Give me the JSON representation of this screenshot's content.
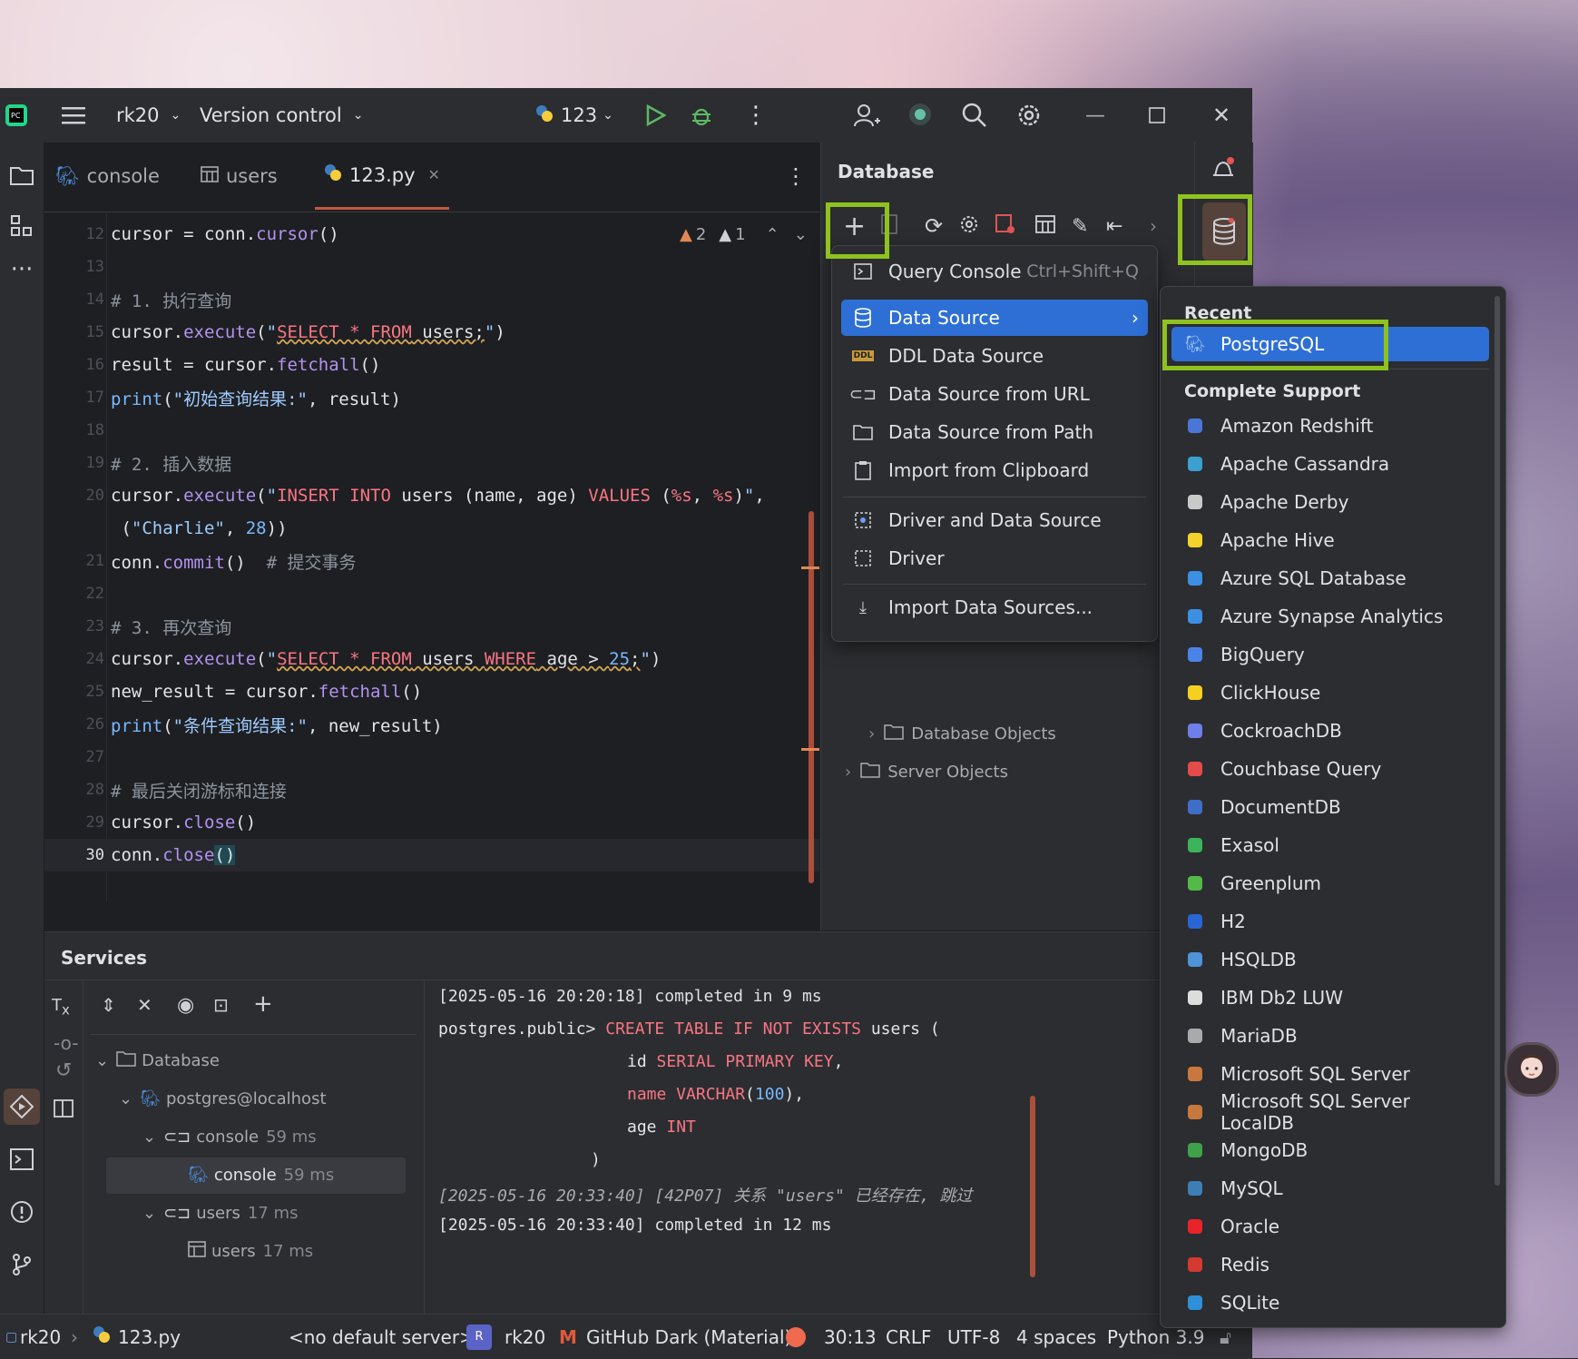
{
  "titlebar": {
    "project": "rk20",
    "vcs": "Version control",
    "run_config": "123"
  },
  "tabs": [
    {
      "label": "console"
    },
    {
      "label": "users"
    },
    {
      "label": "123.py"
    }
  ],
  "inspections": {
    "warnings": "2",
    "weak_warnings": "1"
  },
  "code_lines": [
    {
      "n": "12",
      "text": "cursor = conn.cursor()"
    },
    {
      "n": "13",
      "text": ""
    },
    {
      "n": "14",
      "text": "# 1. 执行查询"
    },
    {
      "n": "15",
      "text": "cursor.execute(\"SELECT * FROM users;\")"
    },
    {
      "n": "16",
      "text": "result = cursor.fetchall()"
    },
    {
      "n": "17",
      "text": "print(\"初始查询结果:\", result)"
    },
    {
      "n": "18",
      "text": ""
    },
    {
      "n": "19",
      "text": "# 2. 插入数据"
    },
    {
      "n": "20",
      "text": "cursor.execute(\"INSERT INTO users (name, age) VALUES (%s, %s)\","
    },
    {
      "n": "",
      "text": " (\"Charlie\", 28))"
    },
    {
      "n": "21",
      "text": "conn.commit()  # 提交事务"
    },
    {
      "n": "22",
      "text": ""
    },
    {
      "n": "23",
      "text": "# 3. 再次查询"
    },
    {
      "n": "24",
      "text": "cursor.execute(\"SELECT * FROM users WHERE age > 25;\")"
    },
    {
      "n": "25",
      "text": "new_result = cursor.fetchall()"
    },
    {
      "n": "26",
      "text": "print(\"条件查询结果:\", new_result)"
    },
    {
      "n": "27",
      "text": ""
    },
    {
      "n": "28",
      "text": "# 最后关闭游标和连接"
    },
    {
      "n": "29",
      "text": "cursor.close()"
    },
    {
      "n": "30",
      "text": "conn.close()"
    }
  ],
  "database_panel": {
    "title": "Database",
    "tree": [
      {
        "label": "Database Objects"
      },
      {
        "label": "Server Objects"
      }
    ]
  },
  "add_menu": {
    "items": [
      {
        "label": "Query Console",
        "shortcut": "Ctrl+Shift+Q"
      },
      {
        "label": "Data Source"
      },
      {
        "label": "DDL Data Source"
      },
      {
        "label": "Data Source from URL"
      },
      {
        "label": "Data Source from Path"
      },
      {
        "label": "Import from Clipboard"
      },
      {
        "label": "Driver and Data Source"
      },
      {
        "label": "Driver"
      },
      {
        "label": "Import Data Sources..."
      }
    ]
  },
  "submenu": {
    "recent_header": "Recent",
    "recent": [
      "PostgreSQL"
    ],
    "complete_header": "Complete Support",
    "drivers": [
      "Amazon Redshift",
      "Apache Cassandra",
      "Apache Derby",
      "Apache Hive",
      "Azure SQL Database",
      "Azure Synapse Analytics",
      "BigQuery",
      "ClickHouse",
      "CockroachDB",
      "Couchbase Query",
      "DocumentDB",
      "Exasol",
      "Greenplum",
      "H2",
      "HSQLDB",
      "IBM Db2 LUW",
      "MariaDB",
      "Microsoft SQL Server",
      "Microsoft SQL Server LocalDB",
      "MongoDB",
      "MySQL",
      "Oracle",
      "Redis",
      "SQLite"
    ],
    "icon_colors": [
      "#4a76d8",
      "#3aa0d0",
      "#c9c9c9",
      "#f2d22b",
      "#3d8fe3",
      "#3d8fe3",
      "#4b84e8",
      "#f5d020",
      "#6f7eea",
      "#e44b4b",
      "#3f6ec9",
      "#3db35b",
      "#54b948",
      "#2966d4",
      "#4f93d8",
      "#dddddd",
      "#aaaaaa",
      "#c8783e",
      "#c8783e",
      "#3ea24a",
      "#3d7fb5",
      "#e8232a",
      "#d43a2f",
      "#2f8fd8"
    ]
  },
  "services": {
    "title": "Services",
    "tree": [
      {
        "label": "Database",
        "ms": ""
      },
      {
        "label": "postgres@localhost",
        "ms": ""
      },
      {
        "label": "console",
        "ms": "59 ms"
      },
      {
        "label": "console",
        "ms": "59 ms"
      },
      {
        "label": "users",
        "ms": "17 ms"
      },
      {
        "label": "users",
        "ms": "17 ms"
      }
    ],
    "console": [
      "[2025-05-16 20:20:18] completed in 9 ms",
      "postgres.public> CREATE TABLE IF NOT EXISTS users (",
      "id SERIAL PRIMARY KEY,",
      "name VARCHAR(100),",
      "age INT",
      ")",
      "[2025-05-16 20:33:40] [42P07] 关系 \"users\" 已经存在, 跳过",
      "[2025-05-16 20:33:40] completed in 12 ms"
    ]
  },
  "statusbar": {
    "project": "rk20",
    "file": "123.py",
    "server": "<no default server>",
    "avatar_letter": "R",
    "user": "rk20",
    "theme": "GitHub Dark (Material)",
    "position": "30:13",
    "line_sep": "CRLF",
    "encoding": "UTF-8",
    "indent": "4 spaces",
    "interpreter": "Python 3.9"
  }
}
